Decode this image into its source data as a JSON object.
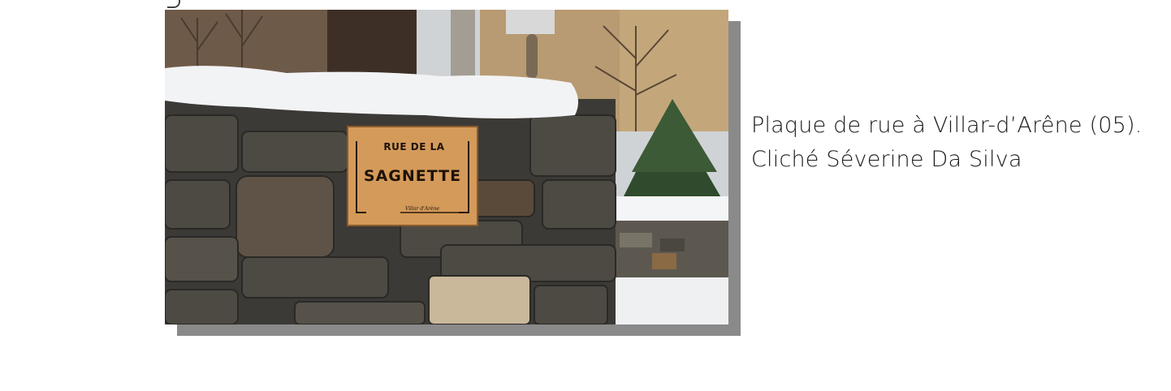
{
  "figure": {
    "photo": {
      "description_icon": "street-sign-photo",
      "sign": {
        "line1": "RUE DE LA",
        "line2": "SAGNETTE",
        "line3": "Villar d'Arène"
      }
    },
    "caption": {
      "line1": "Plaque de rue à Villar-d’Arêne (05).",
      "line2": "Cliché Séverine Da Silva"
    }
  },
  "colors": {
    "shadow": "#8a8a8a",
    "caption_text": "#1a1a1a",
    "sign_wood": "#d49a5a"
  }
}
